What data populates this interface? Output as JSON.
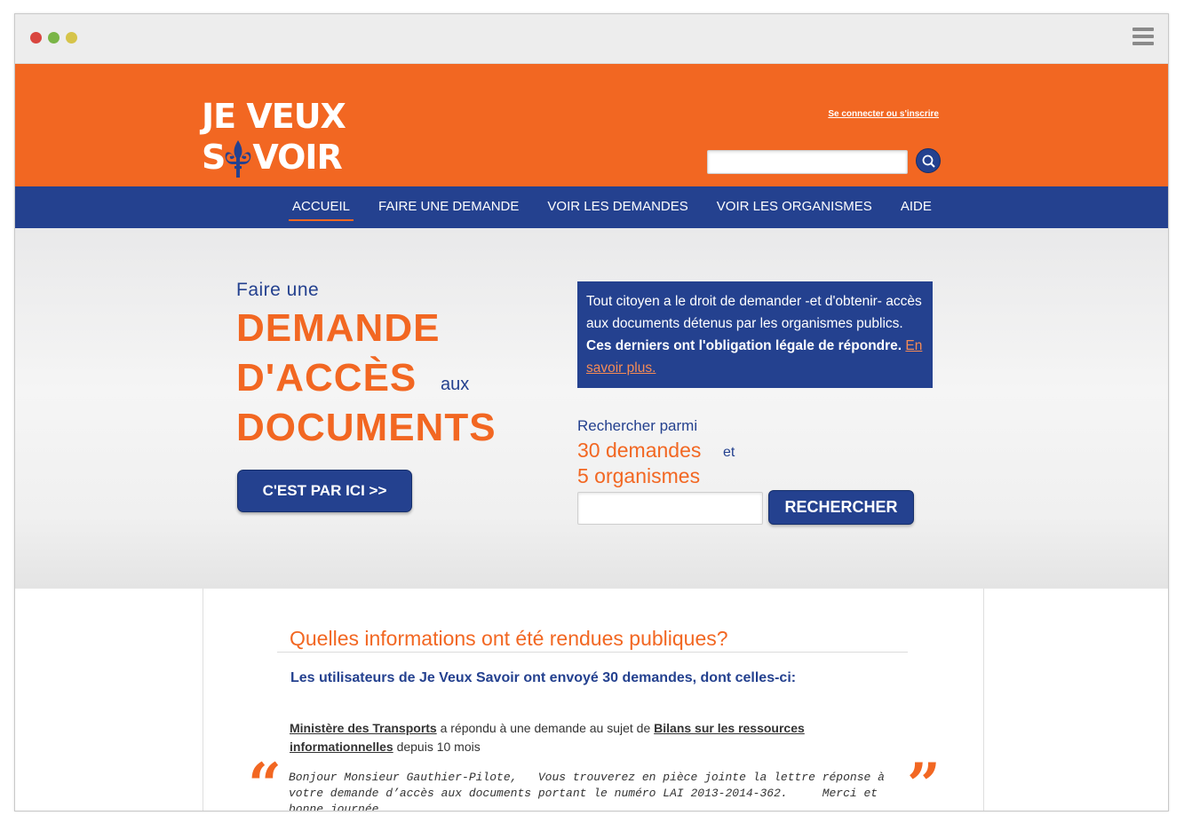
{
  "window": {
    "controls": [
      "close",
      "minimize",
      "zoom"
    ],
    "menu_icon": "hamburger-icon"
  },
  "header": {
    "logo_line1": "JE VEUX",
    "logo_line2_start": "S",
    "logo_line2_end": "VOIR",
    "logo_icon": "fleur-de-lis-icon",
    "login_link": "Se connecter ou s'inscrire",
    "search_placeholder": "",
    "search_icon": "search-icon"
  },
  "nav": {
    "items": [
      {
        "label": "ACCUEIL",
        "active": true
      },
      {
        "label": "FAIRE UNE DEMANDE",
        "active": false
      },
      {
        "label": "VOIR LES DEMANDES",
        "active": false
      },
      {
        "label": "VOIR LES ORGANISMES",
        "active": false
      },
      {
        "label": "AIDE",
        "active": false
      }
    ]
  },
  "hero": {
    "pre": "Faire une",
    "line1": "DEMANDE",
    "line2": "D'ACCÈS",
    "aux": "aux",
    "line3": "DOCUMENTS",
    "cta": "C'EST PAR ICI  >>",
    "info_text": "Tout citoyen a le droit de demander -et d'obtenir- accès aux documents détenus par les organismes publics. ",
    "info_bold": "Ces derniers ont l'obligation légale de répondre.",
    "info_link": "En savoir plus.",
    "search_pre": "Rechercher parmi",
    "count_requests": "30 demandes",
    "et": "et",
    "count_orgs": "5 organismes",
    "search_placeholder": "",
    "search_button": "RECHERCHER"
  },
  "content": {
    "title": "Quelles informations ont été rendues publiques?",
    "subtitle": "Les utilisateurs de Je Veux Savoir ont envoyé 30 demandes, dont celles-ci:",
    "request": {
      "org": "Ministère des Transports",
      "mid": " a répondu à une demande au sujet de ",
      "subject": "Bilans sur les ressources informationnelles",
      "when": " depuis 10 mois"
    },
    "quote_open": "“",
    "quote_close": "”",
    "quote": "Bonjour Monsieur Gauthier-Pilote,   Vous trouverez en pièce jointe la lettre réponse à votre demande d’accès aux documents portant le numéro LAI 2013-2014-362.     Merci et bonne journée.  ..."
  },
  "colors": {
    "orange": "#f26722",
    "blue": "#24418f",
    "light_bg": "#f0f0f0"
  }
}
